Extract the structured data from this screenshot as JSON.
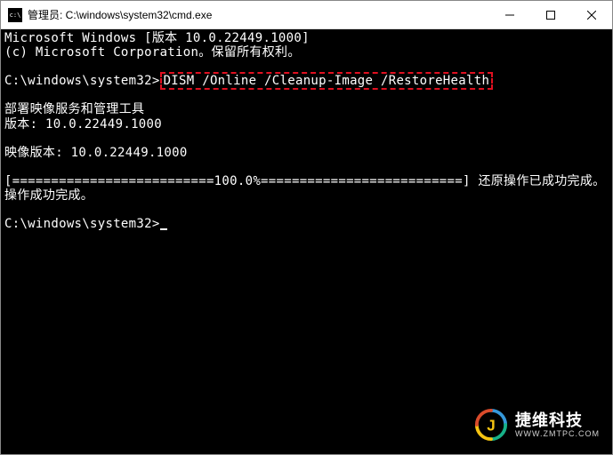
{
  "titlebar": {
    "title": "管理员: C:\\windows\\system32\\cmd.exe"
  },
  "terminal": {
    "line1": "Microsoft Windows [版本 10.0.22449.1000]",
    "line2": "(c) Microsoft Corporation。保留所有权利。",
    "prompt1_path": "C:\\windows\\system32>",
    "prompt1_cmd": "DISM /Online /Cleanup-Image /RestoreHealth",
    "dism_title": "部署映像服务和管理工具",
    "dism_version": "版本: 10.0.22449.1000",
    "image_version": "映像版本: 10.0.22449.1000",
    "progress_line": "[==========================100.0%==========================] 还原操作已成功完成。",
    "success_line": "操作成功完成。",
    "prompt2_path": "C:\\windows\\system32>"
  },
  "watermark": {
    "cn": "捷维科技",
    "en": "WWW.ZMTPC.COM"
  }
}
